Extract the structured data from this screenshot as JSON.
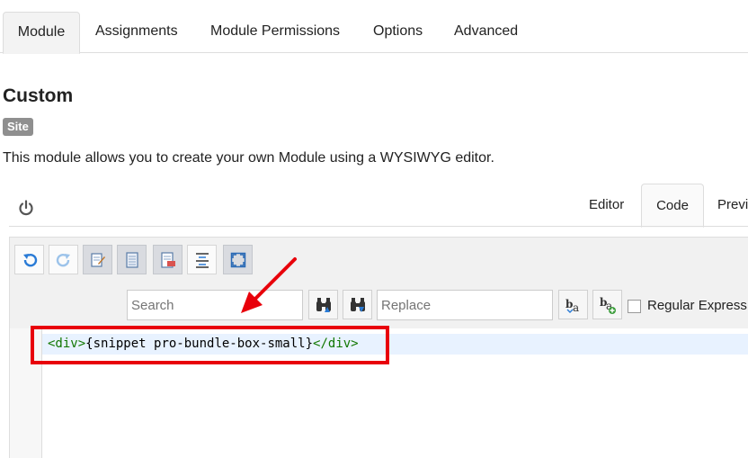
{
  "top_tabs": [
    {
      "label": "Module",
      "active": true
    },
    {
      "label": "Assignments"
    },
    {
      "label": "Module Permissions"
    },
    {
      "label": "Options"
    },
    {
      "label": "Advanced"
    }
  ],
  "module": {
    "title": "Custom",
    "badge": "Site",
    "description": "This module allows you to create your own Module using a WYSIWYG editor."
  },
  "editor": {
    "tabs": {
      "editor": "Editor",
      "code": "Code",
      "preview": "Previ"
    },
    "active_tab": "Code",
    "toolbar_icons": [
      "undo-icon",
      "redo-icon",
      "edit-icon",
      "paste-icon",
      "format-icon",
      "align-center-icon",
      "fullscreen-icon"
    ],
    "search_placeholder": "Search",
    "replace_placeholder": "Replace",
    "regex_label": "Regular Express",
    "code": {
      "open_tag": "<div>",
      "content": "{snippet pro-bundle-box-small}",
      "close_tag": "</div>"
    }
  },
  "annotation_color": "#e8000b"
}
